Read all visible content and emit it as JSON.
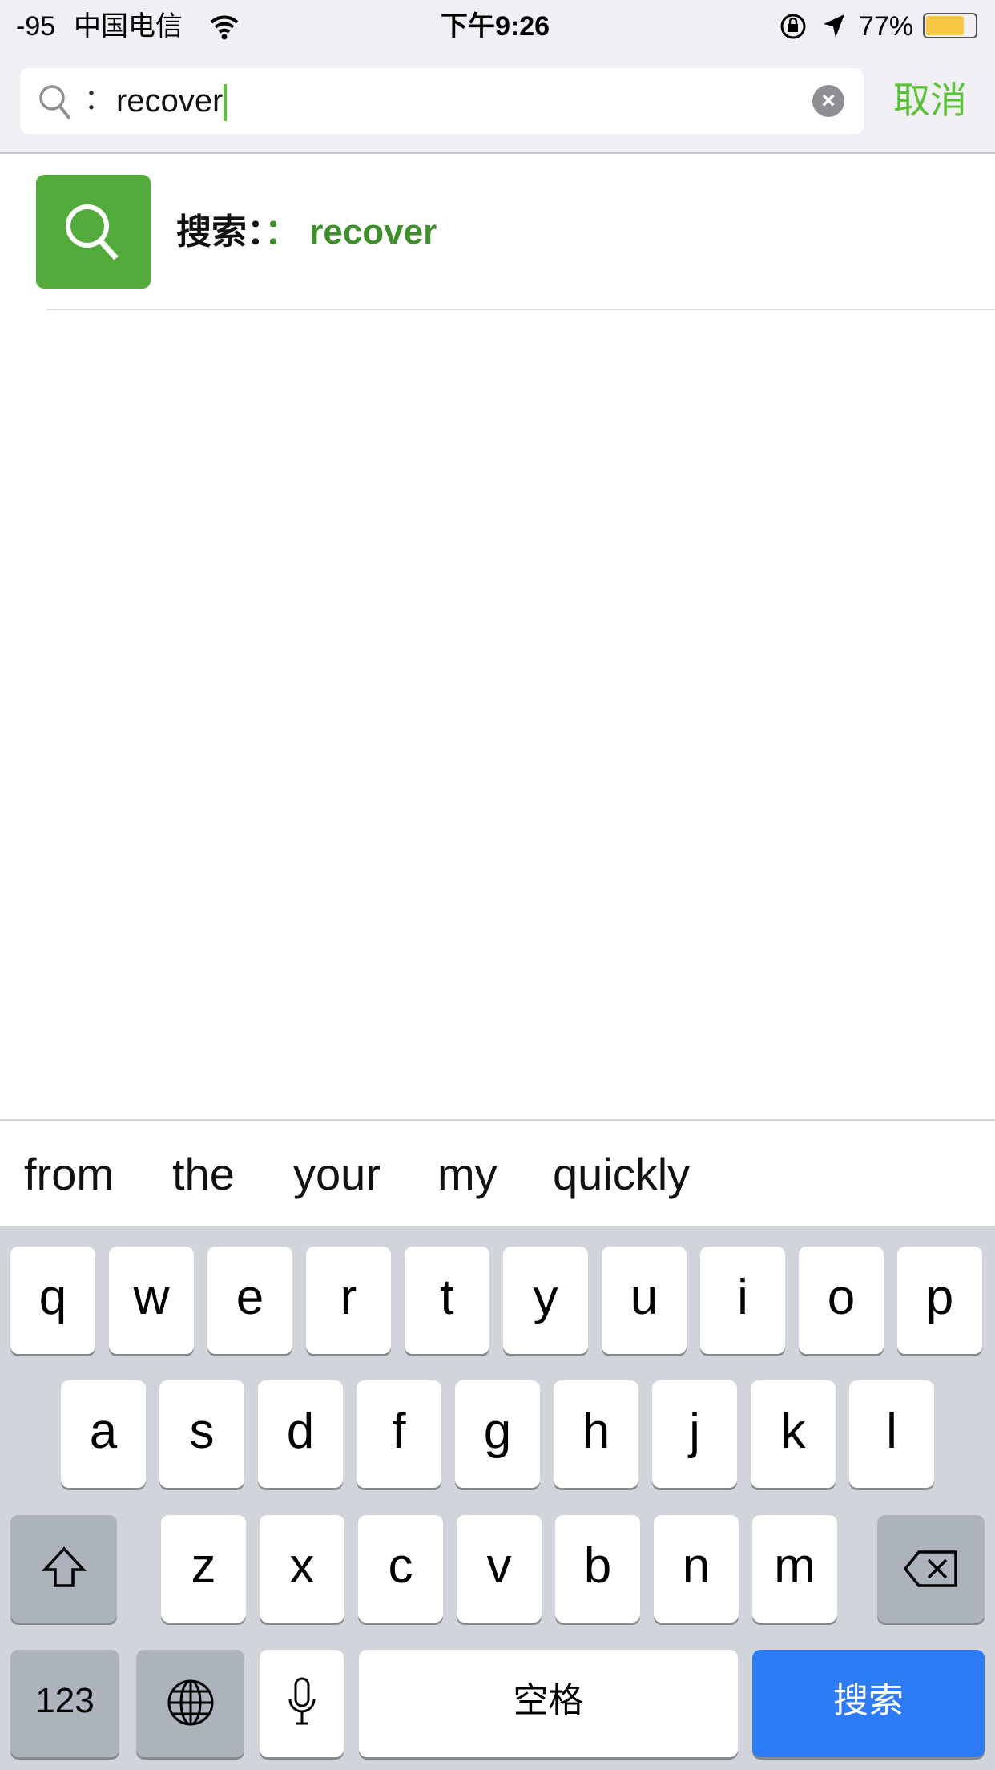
{
  "status_bar": {
    "signal": "-95",
    "carrier": "中国电信",
    "time": "下午9:26",
    "battery": "77%",
    "battery_color": "#f9c842"
  },
  "search": {
    "prefix": "：",
    "query": "recover",
    "cancel_label": "取消"
  },
  "result": {
    "label": "搜索：",
    "colon": "：",
    "query": "recover",
    "icon_color": "#52ab3a"
  },
  "suggestions": [
    "from",
    "the",
    "your",
    "my",
    "quickly"
  ],
  "keyboard": {
    "row1": [
      "q",
      "w",
      "e",
      "r",
      "t",
      "y",
      "u",
      "i",
      "o",
      "p"
    ],
    "row2": [
      "a",
      "s",
      "d",
      "f",
      "g",
      "h",
      "j",
      "k",
      "l"
    ],
    "row3": [
      "z",
      "x",
      "c",
      "v",
      "b",
      "n",
      "m"
    ],
    "numbers_label": "123",
    "space_label": "空格",
    "search_label": "搜索",
    "accent": "#2d7cf6"
  }
}
